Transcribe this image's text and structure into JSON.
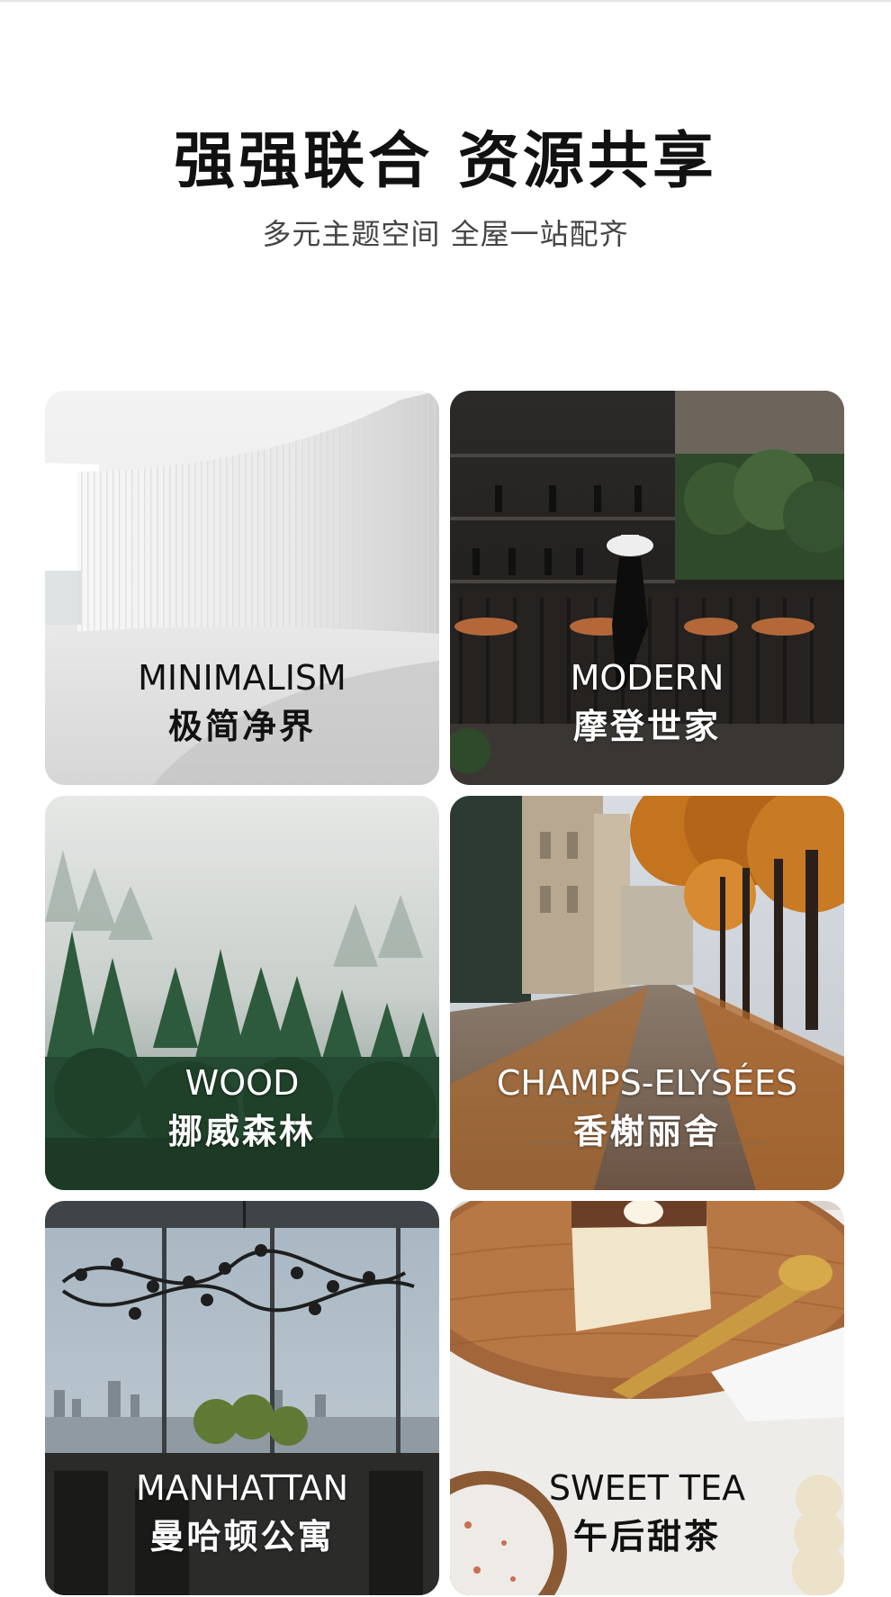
{
  "header": {
    "title": "强强联合 资源共享",
    "subtitle": "多元主题空间 全屋一站配齐"
  },
  "themes": [
    {
      "en": "MINIMALISM",
      "cn": "极简净界"
    },
    {
      "en": "MODERN",
      "cn": "摩登世家"
    },
    {
      "en": "WOOD",
      "cn": "挪威森林"
    },
    {
      "en": "CHAMPS-ELYSÉES",
      "cn": "香榭丽舍"
    },
    {
      "en": "MANHATTAN",
      "cn": "曼哈顿公寓"
    },
    {
      "en": "SWEET TEA",
      "cn": "午后甜茶"
    }
  ]
}
